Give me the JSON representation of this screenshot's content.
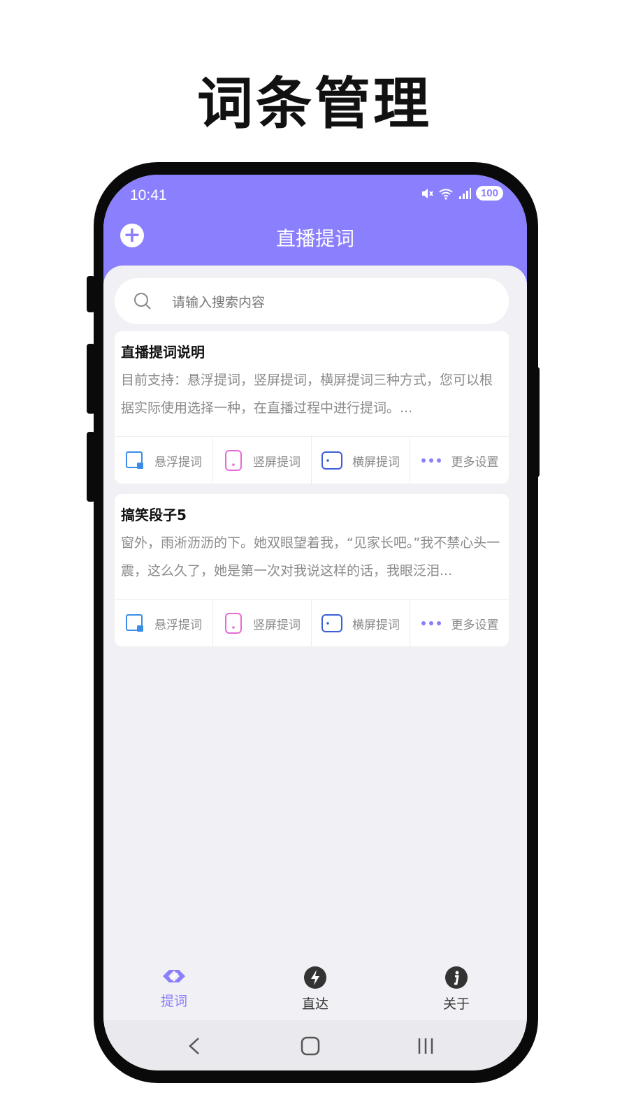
{
  "headline": "词条管理",
  "status": {
    "time": "10:41",
    "battery": "100"
  },
  "app": {
    "title": "直播提词"
  },
  "search": {
    "placeholder": "请输入搜索内容"
  },
  "cards": [
    {
      "title": "直播提词说明",
      "body": "目前支持：悬浮提词，竖屏提词，横屏提词三种方式，您可以根据实际使用选择一种，在直播过程中进行提词。...",
      "actions": [
        "悬浮提词",
        "竖屏提词",
        "横屏提词",
        "更多设置"
      ]
    },
    {
      "title": "搞笑段子5",
      "body": "窗外，雨淅沥沥的下。她双眼望着我，“见家长吧。”我不禁心头一震，这么久了，她是第一次对我说这样的话，我眼泛泪...",
      "actions": [
        "悬浮提词",
        "竖屏提词",
        "横屏提词",
        "更多设置"
      ]
    }
  ],
  "nav": [
    {
      "label": "提词",
      "icon": "prompt-icon",
      "active": true
    },
    {
      "label": "直达",
      "icon": "lightning-icon",
      "active": false
    },
    {
      "label": "关于",
      "icon": "info-icon",
      "active": false
    }
  ],
  "colors": {
    "accent": "#8a7ffc",
    "float": "#3b8de6",
    "portrait": "#e66ad6",
    "landscape": "#3c5fd6"
  }
}
